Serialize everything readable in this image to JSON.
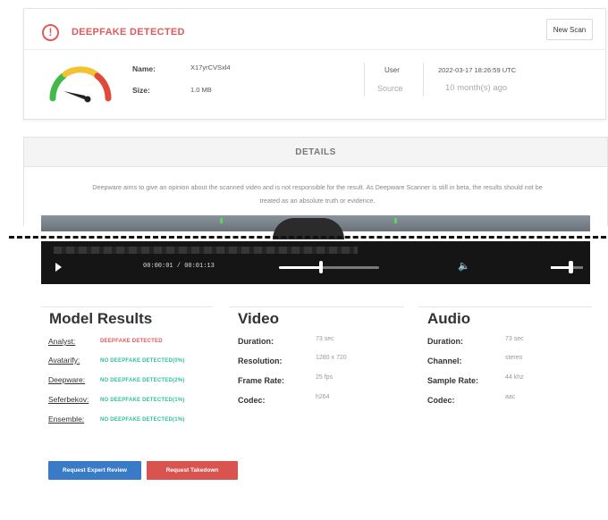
{
  "header": {
    "alert_icon": "exclamation-circle-icon",
    "alert_text": "DEEPFAKE DETECTED",
    "new_scan_label": "New Scan",
    "colors": {
      "alert": "#e05a5a"
    }
  },
  "summary": {
    "gauge_icon": "deepfake-gauge-icon",
    "name_label": "Name:",
    "name_value": "X17yrCVSxl4",
    "size_label": "Size:",
    "size_value": "1.0 MB",
    "user_label": "User",
    "source_label": "Source",
    "date_value": "2022-03-17 18:26:59 UTC",
    "ago_value": "10 month(s) ago"
  },
  "details": {
    "heading": "DETAILS",
    "disclaimer_line1": "Deepware aims to give an opinion about the scanned video and is not responsible for the result. As Deepware Scanner is still in beta, the results should not be",
    "disclaimer_line2": "treated as an absolute truth or evidence."
  },
  "player": {
    "play_icon": "play-icon",
    "time": "00:00:01 / 00:01:13",
    "progress_fraction": 0.42,
    "volume_icon": "volume-icon",
    "volume_fraction": 0.62
  },
  "model_results": {
    "title": "Model Results",
    "items": [
      {
        "name": "Analyst:",
        "result": "DEEPFAKE DETECTED",
        "status": "fake"
      },
      {
        "name": "Avatarify:",
        "result": "NO DEEPFAKE DETECTED(0%)",
        "status": "ok"
      },
      {
        "name": "Deepware:",
        "result": "NO DEEPFAKE DETECTED(2%)",
        "status": "ok"
      },
      {
        "name": "Seferbekov:",
        "result": "NO DEEPFAKE DETECTED(1%)",
        "status": "ok"
      },
      {
        "name": "Ensemble:",
        "result": "NO DEEPFAKE DETECTED(1%)",
        "status": "ok"
      }
    ],
    "colors": {
      "fake": "#e05a5a",
      "ok": "#2fbf9b"
    }
  },
  "video": {
    "title": "Video",
    "rows": [
      {
        "label": "Duration:",
        "value": "73 sec"
      },
      {
        "label": "Resolution:",
        "value": "1280 x 720"
      },
      {
        "label": "Frame Rate:",
        "value": "25 fps"
      },
      {
        "label": "Codec:",
        "value": "h264"
      }
    ]
  },
  "audio": {
    "title": "Audio",
    "rows": [
      {
        "label": "Duration:",
        "value": "73 sec"
      },
      {
        "label": "Channel:",
        "value": "stereo"
      },
      {
        "label": "Sample Rate:",
        "value": "44 khz"
      },
      {
        "label": "Codec:",
        "value": "aac"
      }
    ]
  },
  "actions": {
    "expert_review_label": "Request Expert Review",
    "takedown_label": "Request Takedown",
    "colors": {
      "expert": "#3a7bc8",
      "takedown": "#d9534f"
    }
  }
}
